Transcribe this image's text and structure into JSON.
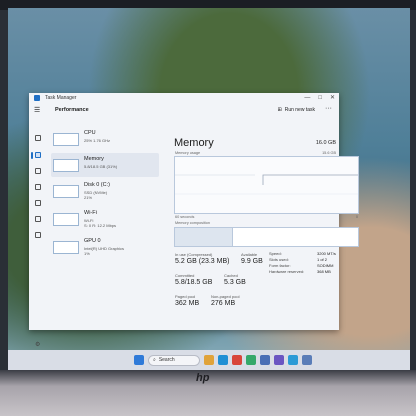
{
  "window": {
    "title": "Task Manager",
    "minimize": "—",
    "maximize": "□",
    "close": "✕"
  },
  "header": {
    "section": "Performance",
    "run_new_task": "Run new task",
    "more": "···"
  },
  "resources": [
    {
      "name": "CPU",
      "sub1": "25% 1.76 GHz",
      "sub2": ""
    },
    {
      "name": "Memory",
      "sub1": "5.8/18.5 GB (31%)",
      "sub2": ""
    },
    {
      "name": "Disk 0 (C:)",
      "sub1": "SSD (NVMe)",
      "sub2": "21%"
    },
    {
      "name": "Wi-Fi",
      "sub1": "Wi-Fi",
      "sub2": "S: 0 R: 12.2 Mbps"
    },
    {
      "name": "GPU 0",
      "sub1": "Intel(R) UHD Graphics",
      "sub2": "1%"
    }
  ],
  "memory": {
    "title": "Memory",
    "total": "16.0 GB",
    "usage_label": "Memory usage",
    "usage_max": "15.6 GB",
    "seconds": "60 seconds",
    "zero": "0",
    "composition_label": "Memory composition",
    "composition_used_fraction": 0.31,
    "in_use_label": "In use (Compressed)",
    "in_use_value": "5.2 GB (23.3 MB)",
    "available_label": "Available",
    "available_value": "9.9 GB",
    "committed_label": "Committed",
    "committed_value": "5.8/18.5 GB",
    "cached_label": "Cached",
    "cached_value": "5.3 GB",
    "paged_label": "Paged pool",
    "paged_value": "362 MB",
    "nonpaged_label": "Non-paged pool",
    "nonpaged_value": "276 MB",
    "specs": [
      {
        "key": "Speed:",
        "value": "3200 MT/s"
      },
      {
        "key": "Slots used:",
        "value": "1 of 2"
      },
      {
        "key": "Form factor:",
        "value": "SODIMM"
      },
      {
        "key": "Hardware reserved:",
        "value": "368 MB"
      }
    ]
  },
  "taskbar": {
    "search_placeholder": "Search"
  },
  "brand": "hp",
  "icons": {
    "hamburger": "hamburger-icon",
    "settings": "gear-icon"
  },
  "colors": {
    "accent": "#1f6fc5"
  }
}
